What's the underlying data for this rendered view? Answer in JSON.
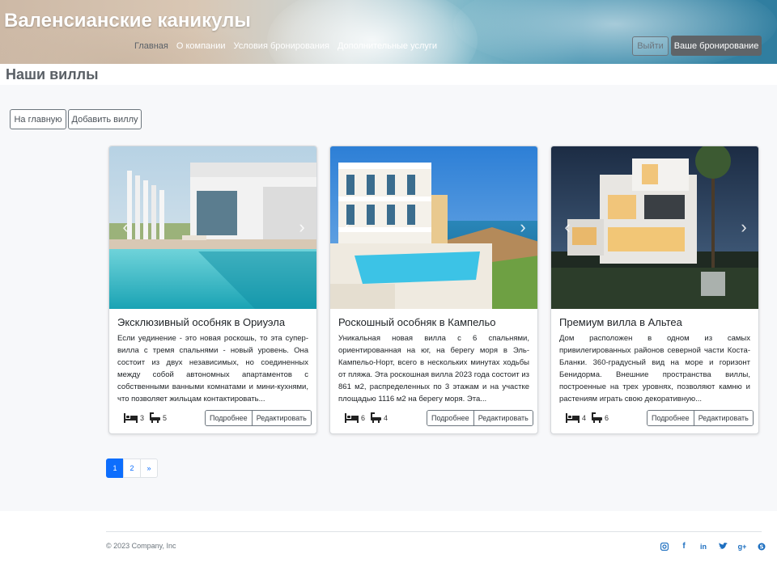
{
  "header": {
    "brand": "Валенсианские каникулы",
    "nav": [
      {
        "label": "Главная"
      },
      {
        "label": "О компании"
      },
      {
        "label": "Условия бронирования"
      },
      {
        "label": "Дополнительные услуги"
      }
    ],
    "logout_label": "Выйти",
    "booking_label": "Ваше бронирование"
  },
  "page": {
    "title": "Наши виллы",
    "home_button": "На главную",
    "add_button": "Добавить виллу"
  },
  "villas": [
    {
      "title": "Эксклюзивный особняк в Ориуэла",
      "description": "Если уединение - это новая роскошь, то эта супер-вилла с тремя спальнями - новый уровень. Она состоит из двух независимых, но соединенных между собой автономных апартаментов с собственными ванными комнатами и мини-кухнями, что позволяет жильцам контактировать...",
      "bedrooms": "3",
      "bathrooms": "5",
      "details_label": "Подробнее",
      "edit_label": "Редактировать"
    },
    {
      "title": "Роскошный особняк в Кампельо",
      "description": "Уникальная новая вилла с 6 спальнями, ориентированная на юг, на берегу моря в Эль-Кампельо-Норт, всего в нескольких минутах ходьбы от пляжа. Эта роскошная вилла 2023 года состоит из 861 м2, распределенных по 3 этажам и на участке площадью 1116 м2 на берегу моря. Эта...",
      "bedrooms": "6",
      "bathrooms": "4",
      "details_label": "Подробнее",
      "edit_label": "Редактировать"
    },
    {
      "title": "Премиум вилла в Альтеа",
      "description": "Дом расположен в одном из самых привилегированных районов северной части Коста-Бланки. 360-градусный вид на море и горизонт Бенидорма. Внешние пространства виллы, построенные на трех уровнях, позволяют камню и растениям играть свою декоративную...",
      "bedrooms": "4",
      "bathrooms": "6",
      "details_label": "Подробнее",
      "edit_label": "Редактировать"
    }
  ],
  "pagination": {
    "pages": [
      "1",
      "2",
      "»"
    ],
    "current": "1"
  },
  "footer": {
    "copyright": "© 2023 Company, Inc",
    "social_icons": [
      "instagram-icon",
      "facebook-icon",
      "linkedin-icon",
      "twitter-icon",
      "google-plus-icon",
      "skype-icon"
    ]
  },
  "colors": {
    "accent": "#0d6efd",
    "social": "#1d6fc0",
    "booking_button": "#5f6468"
  }
}
